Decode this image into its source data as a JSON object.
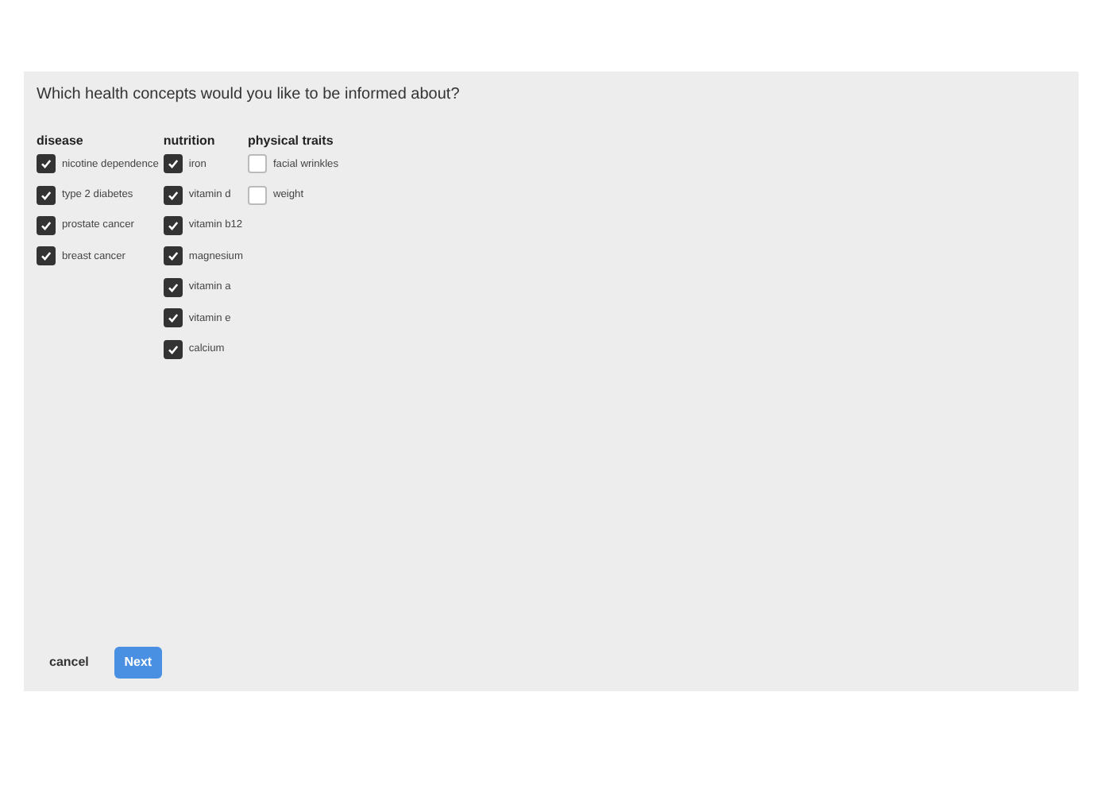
{
  "question": "Which health concepts would you like to be informed about?",
  "groups": [
    {
      "title": "disease",
      "options": [
        {
          "label": "nicotine dependence",
          "checked": true
        },
        {
          "label": "type 2 diabetes",
          "checked": true
        },
        {
          "label": "prostate cancer",
          "checked": true
        },
        {
          "label": "breast cancer",
          "checked": true
        }
      ]
    },
    {
      "title": "nutrition",
      "options": [
        {
          "label": "iron",
          "checked": true
        },
        {
          "label": "vitamin d",
          "checked": true
        },
        {
          "label": "vitamin b12",
          "checked": true
        },
        {
          "label": "magnesium",
          "checked": true
        },
        {
          "label": "vitamin a",
          "checked": true
        },
        {
          "label": "vitamin e",
          "checked": true
        },
        {
          "label": "calcium",
          "checked": true
        }
      ]
    },
    {
      "title": "physical traits",
      "options": [
        {
          "label": "facial wrinkles",
          "checked": false
        },
        {
          "label": "weight",
          "checked": false
        }
      ]
    }
  ],
  "buttons": {
    "cancel": "cancel",
    "next": "Next"
  }
}
